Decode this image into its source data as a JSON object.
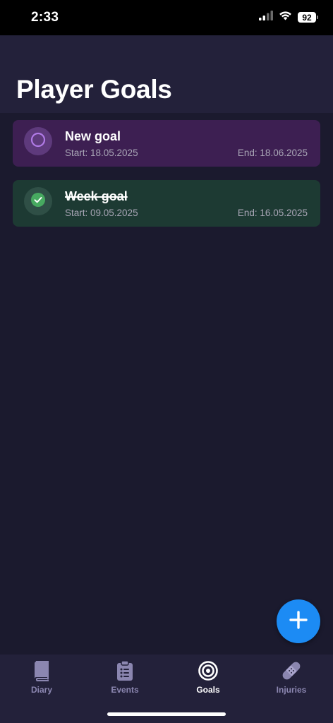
{
  "status_bar": {
    "time": "2:33",
    "battery": "92",
    "icons": [
      "cellular-signal-icon",
      "wifi-icon",
      "battery-icon"
    ]
  },
  "header": {
    "title": "Player Goals"
  },
  "goals": [
    {
      "title": "New goal",
      "start": "Start: 18.05.2025",
      "end": "End: 18.06.2025",
      "completed": false,
      "icon": "empty-circle-icon",
      "color": "#3d1f52"
    },
    {
      "title": "Week goal",
      "start": "Start: 09.05.2025",
      "end": "End: 16.05.2025",
      "completed": true,
      "icon": "checkmark-circle-icon",
      "color": "#1d3a33"
    }
  ],
  "fab": {
    "icon": "plus-icon",
    "color": "#1c8bf4"
  },
  "tab_bar": {
    "tabs": [
      {
        "label": "Diary",
        "icon": "book-icon",
        "active": false
      },
      {
        "label": "Events",
        "icon": "clipboard-list-icon",
        "active": false
      },
      {
        "label": "Goals",
        "icon": "target-icon",
        "active": true
      },
      {
        "label": "Injuries",
        "icon": "bandage-icon",
        "active": false
      }
    ]
  }
}
